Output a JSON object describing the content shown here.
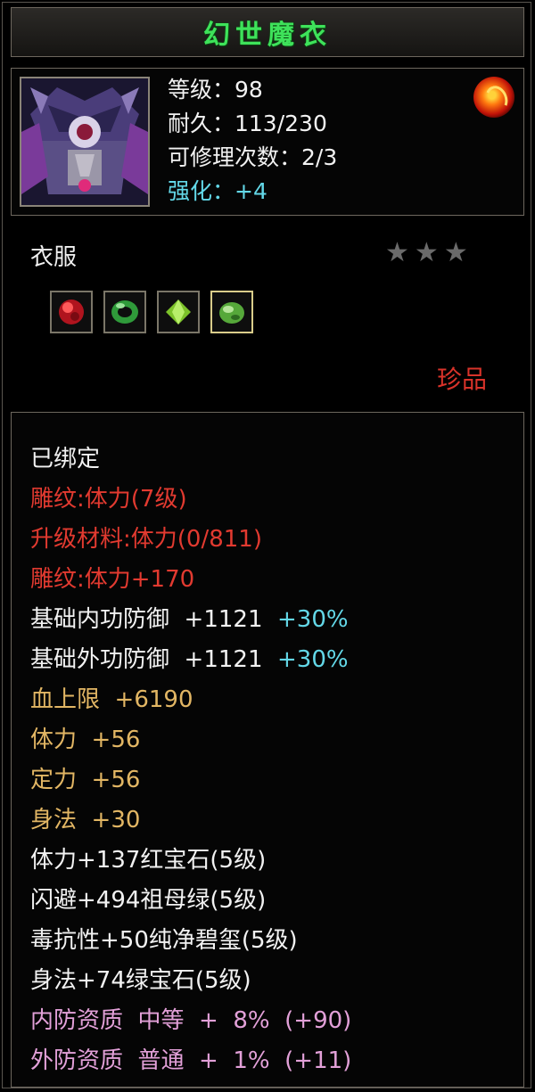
{
  "title": "幻世魔衣",
  "item": {
    "level_text": "等级：98",
    "durability_text": "耐久：113/230",
    "repair_text": "可修理次数：2/3",
    "enhance_label": "强化：",
    "enhance_value": "+4",
    "category": "衣服",
    "rarity": "珍品",
    "stars": [
      "★",
      "★",
      "★"
    ],
    "gems": [
      {
        "icon": "ruby-gem-icon",
        "color": "#d8202a"
      },
      {
        "icon": "emerald-ring-gem-icon",
        "color": "#2f9a3a"
      },
      {
        "icon": "green-crystal-gem-icon",
        "color": "#7cc22a"
      },
      {
        "icon": "green-jade-gem-icon",
        "color": "#56a83a"
      }
    ]
  },
  "colors": {
    "title_green": "#3ee25a",
    "white": "#f2f2f2",
    "red": "#e23a30",
    "cyan": "#63d8e8",
    "gold": "#e2b664",
    "pink": "#e2a0d8",
    "star_gray": "#6a6a6a"
  },
  "properties": [
    {
      "text": "已绑定",
      "color": "#f2f2f2"
    },
    {
      "text": "雕纹:体力(7级)",
      "color": "#e23a30"
    },
    {
      "text": "升级材料:体力(0/811)",
      "color": "#e23a30"
    },
    {
      "text": "雕纹:体力+170",
      "color": "#e23a30"
    },
    {
      "text": "基础内功防御  +1121",
      "suffix": "  +30%",
      "color": "#f2f2f2",
      "suffix_color": "#63d8e8"
    },
    {
      "text": "基础外功防御  +1121",
      "suffix": "  +30%",
      "color": "#f2f2f2",
      "suffix_color": "#63d8e8"
    },
    {
      "text": "血上限  +6190",
      "color": "#e2b664"
    },
    {
      "text": "体力  +56",
      "color": "#e2b664"
    },
    {
      "text": "定力  +56",
      "color": "#e2b664"
    },
    {
      "text": "身法  +30",
      "color": "#e2b664"
    },
    {
      "text": "体力+137红宝石(5级)",
      "color": "#f2f2f2"
    },
    {
      "text": "闪避+494祖母绿(5级)",
      "color": "#f2f2f2"
    },
    {
      "text": "毒抗性+50纯净碧玺(5级)",
      "color": "#f2f2f2"
    },
    {
      "text": "身法+74绿宝石(5级)",
      "color": "#f2f2f2"
    },
    {
      "text": "内防资质  中等  +  8%  (+90)",
      "color": "#e2a0d8"
    },
    {
      "text": "外防资质  普通  +  1%  (+11)",
      "color": "#e2a0d8"
    }
  ]
}
